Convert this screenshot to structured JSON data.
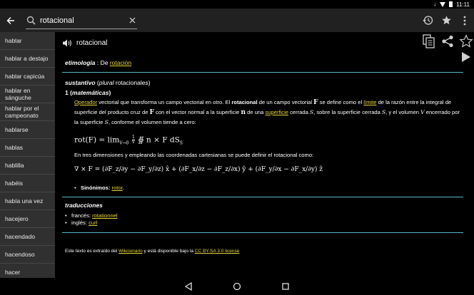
{
  "status": {
    "time": "11:11",
    "download_glyph": "↓"
  },
  "toolbar": {
    "search_value": "rotacional",
    "icons": {
      "back": "arrow-back-icon",
      "search": "search-icon",
      "clear": "close-icon",
      "history": "history-icon",
      "favorite": "star-icon",
      "menu": "more-vert-icon"
    }
  },
  "sidebar": {
    "items": [
      {
        "label": "hablar"
      },
      {
        "label": "hablar a destajo"
      },
      {
        "label": "hablar capicúa"
      },
      {
        "label": "hablar en sánguche"
      },
      {
        "label": "hablar por el campeonato"
      },
      {
        "label": "hablarse"
      },
      {
        "label": "hablas"
      },
      {
        "label": "hablilla"
      },
      {
        "label": "habéis"
      },
      {
        "label": "había una vez"
      },
      {
        "label": "hacejero"
      },
      {
        "label": "hacendado"
      },
      {
        "label": "hacendoso"
      },
      {
        "label": "hacer"
      }
    ]
  },
  "entry": {
    "headword": "rotacional",
    "etimologia": {
      "heading": "etimología",
      "sep": " : De ",
      "link": "rotación"
    },
    "sustantivo": {
      "heading": "sustantivo",
      "plural_open": " (",
      "plural_label": "plural",
      "plural_value": " rotacionales)",
      "sense_num": "1 (",
      "sense_domain": "matemáticas",
      "sense_close": ")"
    },
    "definition": {
      "link1": "Operador",
      "t1": " vectorial que transforma un campo vectorial en otro. El ",
      "bold1": "rotacional",
      "t2": " de un campo vectorial ",
      "F1": "F",
      "t3": " se define como el ",
      "link2": "límite",
      "t4": " de la razón entre la integral de superficie del producto cruz de ",
      "F2": "F",
      "t5": " con el vector normal a la superficie ",
      "n1": "n",
      "t6": " de una ",
      "link3": "superficie",
      "t7": " cerrada ",
      "S1": "S",
      "t8": ", sobre la superficie cerrada ",
      "S2": "S",
      "t9": ", y el volumen ",
      "V1": "V",
      "t10": " encerrado por la superficie ",
      "S3": "S",
      "t11": ", conforme el volumen tiende a cero:"
    },
    "formula1": "rot(F) = lim",
    "formula1_sub": "V→0",
    "formula1_rest": " ∯ n × F dS",
    "formula1_frac_num": "1",
    "formula1_frac_den": "V",
    "formula1_int_sub": "S",
    "paragraph2": "En tres dimensiones y empleando las coordenadas cartesianas se puede definir el rotacional como:",
    "formula2": "∇ × F = (∂F_z/∂y − ∂F_y/∂z) x̂ + (∂F_x/∂z − ∂F_z/∂x) ŷ + (∂F_y/∂x − ∂F_x/∂y) ẑ",
    "sinonimos_label": "Sinónimos:",
    "sinonimos_link": "rotor",
    "sinonimos_end": "."
  },
  "traducciones": {
    "heading": "traducciones",
    "items": [
      {
        "lang": "francés:",
        "word": "rotationnel"
      },
      {
        "lang": "inglés:",
        "word": "curl"
      }
    ]
  },
  "footer": {
    "t1": "Este texto es extraído del ",
    "link1": "Wikcionario",
    "t2": " y está disponible bajo la ",
    "link2": "CC BY-SA 3.0 license"
  },
  "colors": {
    "accent": "#5bb8c7",
    "link": "#e5d437",
    "sidebar_bg": "#303030",
    "toolbar_bg": "#212121"
  }
}
